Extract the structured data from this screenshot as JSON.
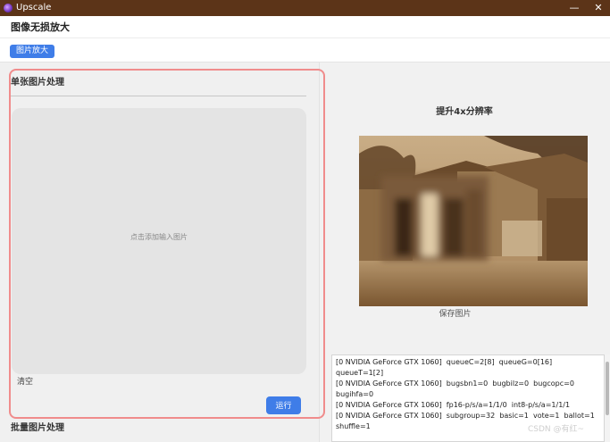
{
  "window": {
    "title": "Upscale",
    "minimize_glyph": "—",
    "close_glyph": "✕"
  },
  "header": {
    "title": "图像无损放大"
  },
  "tabs": [
    {
      "label": "图片放大",
      "active": true
    }
  ],
  "single": {
    "title": "单张图片处理",
    "dropzone_text": "点击添加输入图片",
    "clear_label": "清空",
    "run_label": "运行"
  },
  "batch": {
    "title": "批量图片处理"
  },
  "result": {
    "title": "提升4x分辨率",
    "save_label": "保存图片"
  },
  "log": {
    "lines": [
      "[0 NVIDIA GeForce GTX 1060]  queueC=2[8]  queueG=0[16]  queueT=1[2]",
      "[0 NVIDIA GeForce GTX 1060]  bugsbn1=0  bugbilz=0  bugcopc=0  bugihfa=0",
      "[0 NVIDIA GeForce GTX 1060]  fp16-p/s/a=1/1/0  int8-p/s/a=1/1/1",
      "[0 NVIDIA GeForce GTX 1060]  subgroup=32  basic=1  vote=1  ballot=1  shuffle=1"
    ]
  },
  "watermark": "CSDN @有红~",
  "colors": {
    "titlebar": "#5c3418",
    "accent": "#3f7de8",
    "highlight_border": "#f08c8c",
    "dropzone": "#e4e4e4"
  },
  "icons": {
    "app": "upscale-app-icon"
  }
}
